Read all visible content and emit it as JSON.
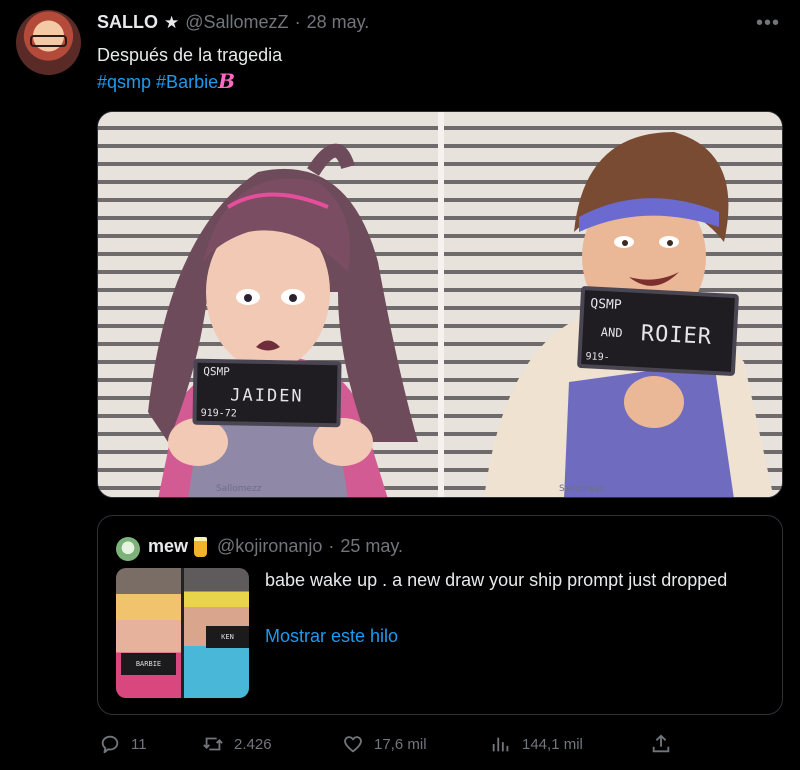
{
  "tweet": {
    "author_name": "SALLO",
    "verified_symbol": "★",
    "handle": "@SallomezZ",
    "separator": "·",
    "date": "28 may.",
    "more_icon": "more-horizontal-icon",
    "text_line1": "Después de la tragedia",
    "hashtags": [
      "#qsmp",
      "#Barbie"
    ],
    "hashtag_emoji": "B"
  },
  "media": {
    "left_sign": {
      "top": "QSMP",
      "name": "JAIDEN",
      "number": "919-72"
    },
    "right_sign": {
      "top": "QSMP",
      "and": "AND",
      "name": "ROIER",
      "number": "919-"
    },
    "watermark": "Sallomezz"
  },
  "quote": {
    "author_name": "mew",
    "handle": "@kojironanjo",
    "separator": "·",
    "date": "25 may.",
    "text": "babe wake up . a new draw your ship prompt just dropped",
    "show_thread": "Mostrar este hilo",
    "thumb_left_sign": "BARBIE",
    "thumb_right_sign": "KEN"
  },
  "actions": {
    "replies": "11",
    "retweets": "2.426",
    "likes": "17,6 mil",
    "views": "144,1 mil"
  },
  "colors": {
    "background": "#000000",
    "text": "#e7e9ea",
    "muted": "#71767b",
    "link": "#1d9bf0",
    "border": "#2f3336"
  }
}
